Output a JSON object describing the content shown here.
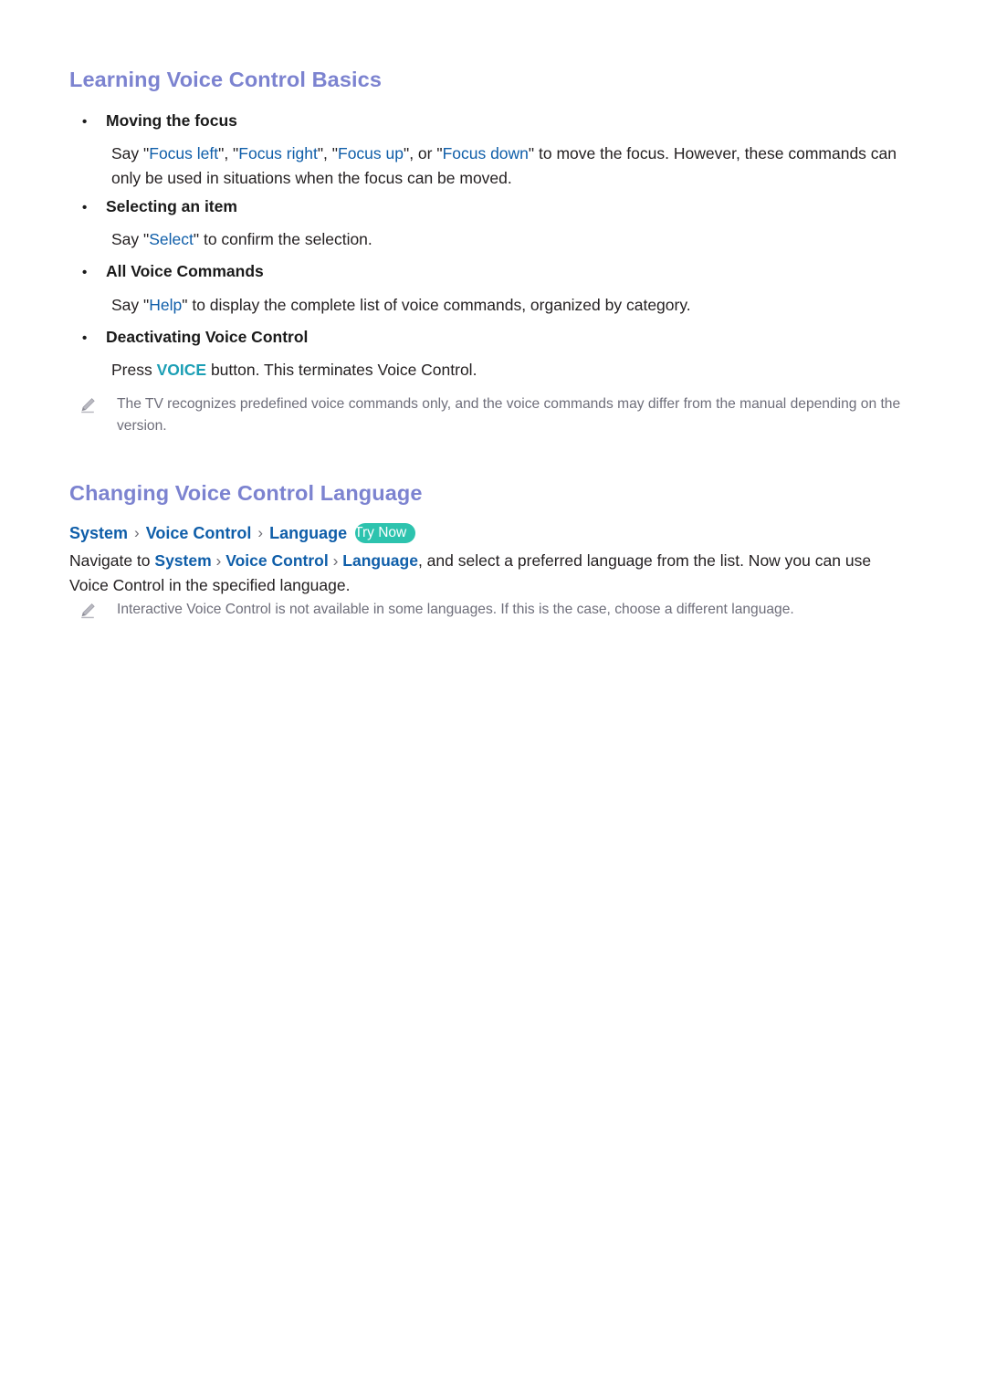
{
  "document": {
    "accent_heading_color": "#7c83d0",
    "link_color": "#0f5ea9",
    "badge_color": "#2dc3ae",
    "note_color": "#6e6e7a"
  },
  "sections": [
    {
      "heading": "Learning Voice Control Basics",
      "items": [
        {
          "bullet_label": "Moving the focus",
          "body_lead": "Say ",
          "quoted_commands": [
            "Focus left",
            "Focus right",
            "Focus up",
            "Focus down"
          ],
          "body_tail": " to move the focus. However, these commands can only be used in situations when the focus can be moved."
        },
        {
          "bullet_label": "Selecting an item",
          "body_lead": "Say ",
          "quoted_commands": [
            "Select"
          ],
          "body_tail": " to confirm the selection."
        },
        {
          "bullet_label": "All Voice Commands",
          "body_lead": "Say ",
          "quoted_commands": [
            "Help"
          ],
          "body_tail": " to display the complete list of voice commands, organized by category."
        },
        {
          "bullet_label": "Deactivating Voice Control",
          "body_lead": "Press ",
          "key_label": "VOICE",
          "body_tail": " button. This terminates Voice Control."
        }
      ],
      "note": "The TV recognizes predefined voice commands only, and the voice commands may differ from the manual depending on the version."
    },
    {
      "heading": "Changing Voice Control Language",
      "breadcrumb": {
        "crumbs": [
          "System",
          "Voice Control",
          "Language"
        ],
        "separator": "›",
        "badge_label": "Try Now"
      },
      "paragraph": {
        "lead": "Navigate to ",
        "crumbs": [
          "System",
          "Voice Control",
          "Language"
        ],
        "separator": "›",
        "tail": ", and select a preferred language from the list. Now you can use Voice Control in the specified language."
      },
      "note": "Interactive Voice Control is not available in some languages. If this is the case, choose a different language."
    }
  ],
  "icons": {
    "pencil": "pencil-icon",
    "bullet": "bullet-dot-icon"
  }
}
